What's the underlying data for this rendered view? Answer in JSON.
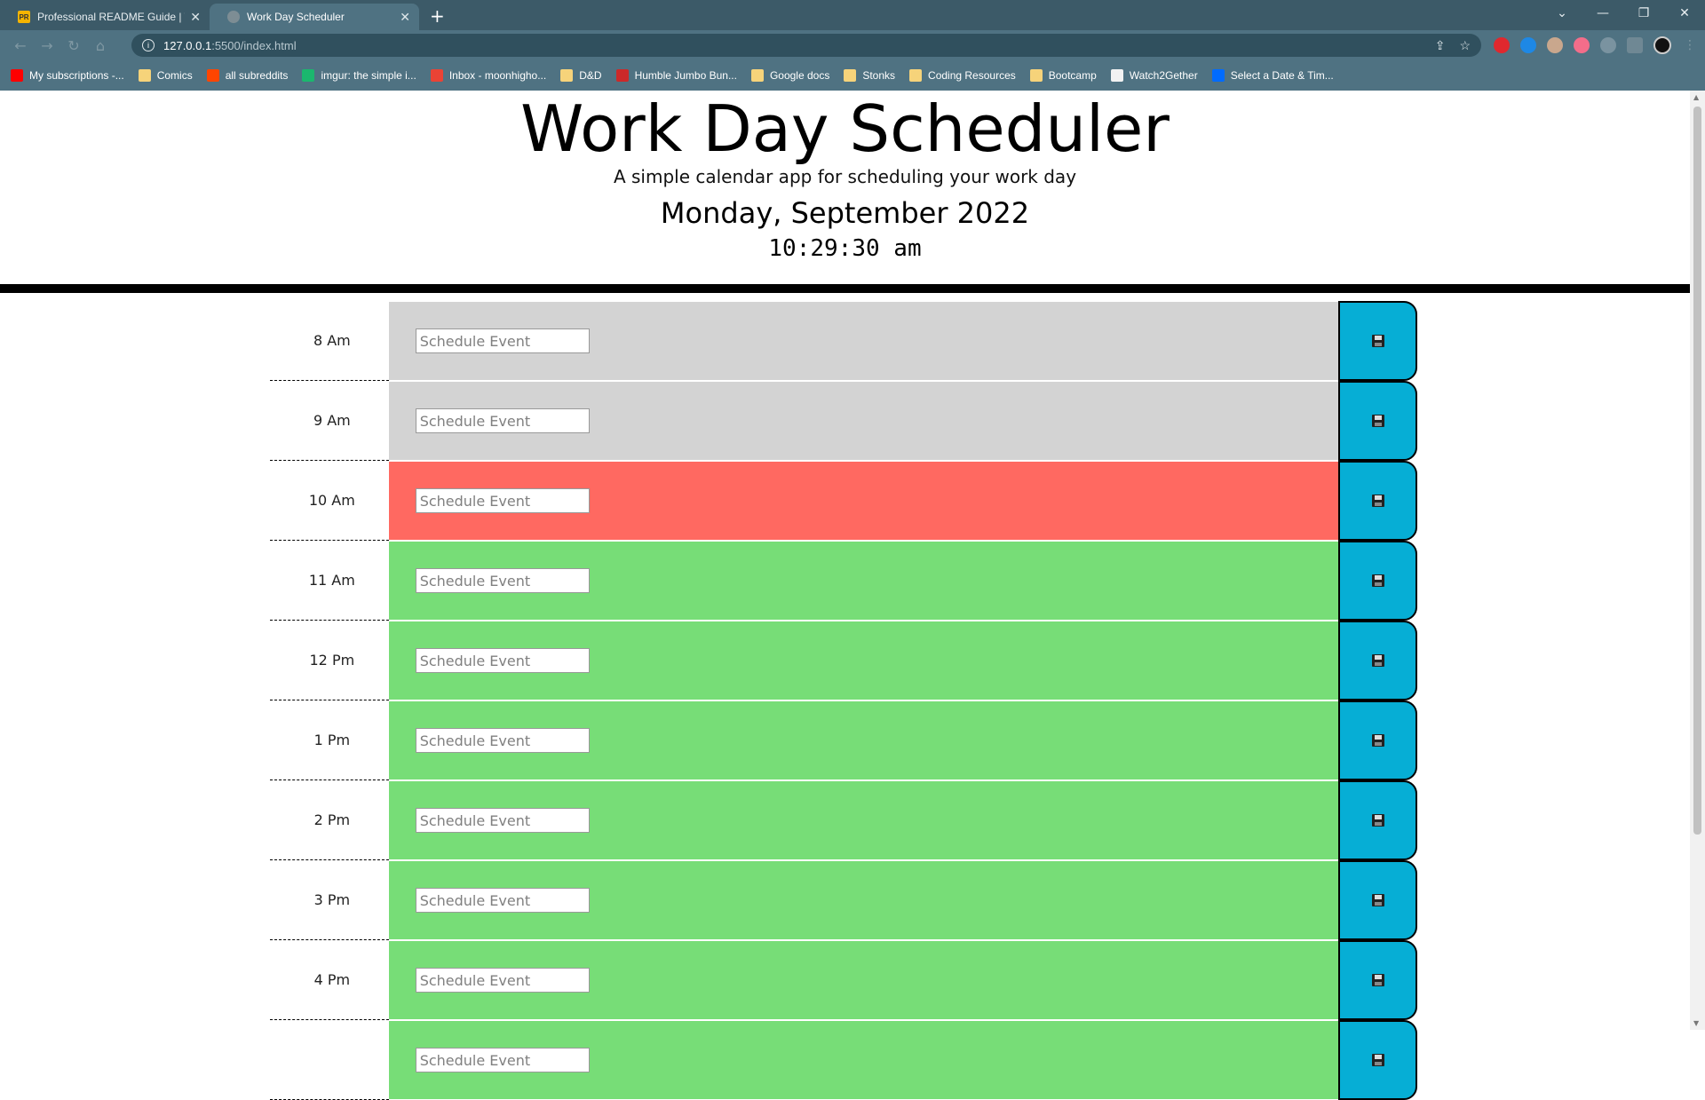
{
  "browser": {
    "tabs": [
      {
        "title": "Professional README Guide | The",
        "favicon_text": "PR",
        "favicon_color": "#f5b400",
        "active": false
      },
      {
        "title": "Work Day Scheduler",
        "favicon_text": "",
        "favicon_color": "#7d8d94",
        "active": true
      }
    ],
    "close_glyph": "✕",
    "new_tab_glyph": "+",
    "window_controls": {
      "dropdown": "⌄",
      "minimize": "—",
      "restore": "❐",
      "close": "✕"
    },
    "url_host": "127.0.0.1",
    "url_rest": ":5500/index.html",
    "info_glyph": "i",
    "share_glyph": "⇪",
    "star_glyph": "☆",
    "bookmarks": [
      {
        "label": "My subscriptions -...",
        "icon": "youtube-icon",
        "color": "#ff0000"
      },
      {
        "label": "Comics",
        "icon": "folder-icon",
        "color": "#f6d37a"
      },
      {
        "label": "all subreddits",
        "icon": "reddit-icon",
        "color": "#ff4500"
      },
      {
        "label": "imgur: the simple i...",
        "icon": "imgur-icon",
        "color": "#1bb76e"
      },
      {
        "label": "Inbox - moonhigho...",
        "icon": "gmail-icon",
        "color": "#ea4335"
      },
      {
        "label": "D&D",
        "icon": "folder-icon",
        "color": "#f6d37a"
      },
      {
        "label": "Humble Jumbo Bun...",
        "icon": "humble-icon",
        "color": "#cc2929"
      },
      {
        "label": "Google docs",
        "icon": "folder-icon",
        "color": "#f6d37a"
      },
      {
        "label": "Stonks",
        "icon": "folder-icon",
        "color": "#f6d37a"
      },
      {
        "label": "Coding Resources",
        "icon": "folder-icon",
        "color": "#f6d37a"
      },
      {
        "label": "Bootcamp",
        "icon": "folder-icon",
        "color": "#f6d37a"
      },
      {
        "label": "Watch2Gether",
        "icon": "w2g-icon",
        "color": "#f2f2f2"
      },
      {
        "label": "Select a Date & Tim...",
        "icon": "calendly-icon",
        "color": "#006bff"
      }
    ]
  },
  "header": {
    "title": "Work Day Scheduler",
    "lead": "A simple calendar app for scheduling your work day",
    "current_day": "Monday, September 2022",
    "current_time": "10:29:30 am"
  },
  "schedule": {
    "placeholder": "Schedule Event",
    "rows": [
      {
        "hour": "8 Am",
        "state": "past"
      },
      {
        "hour": "9 Am",
        "state": "past"
      },
      {
        "hour": "10 Am",
        "state": "present"
      },
      {
        "hour": "11 Am",
        "state": "future"
      },
      {
        "hour": "12 Pm",
        "state": "future"
      },
      {
        "hour": "1 Pm",
        "state": "future"
      },
      {
        "hour": "2 Pm",
        "state": "future"
      },
      {
        "hour": "3 Pm",
        "state": "future"
      },
      {
        "hour": "4 Pm",
        "state": "future"
      },
      {
        "hour": "",
        "state": "future"
      }
    ]
  },
  "colors": {
    "past": "#d3d3d3",
    "present": "#ff6961",
    "future": "#77dd77",
    "save_button": "#06aed5"
  }
}
